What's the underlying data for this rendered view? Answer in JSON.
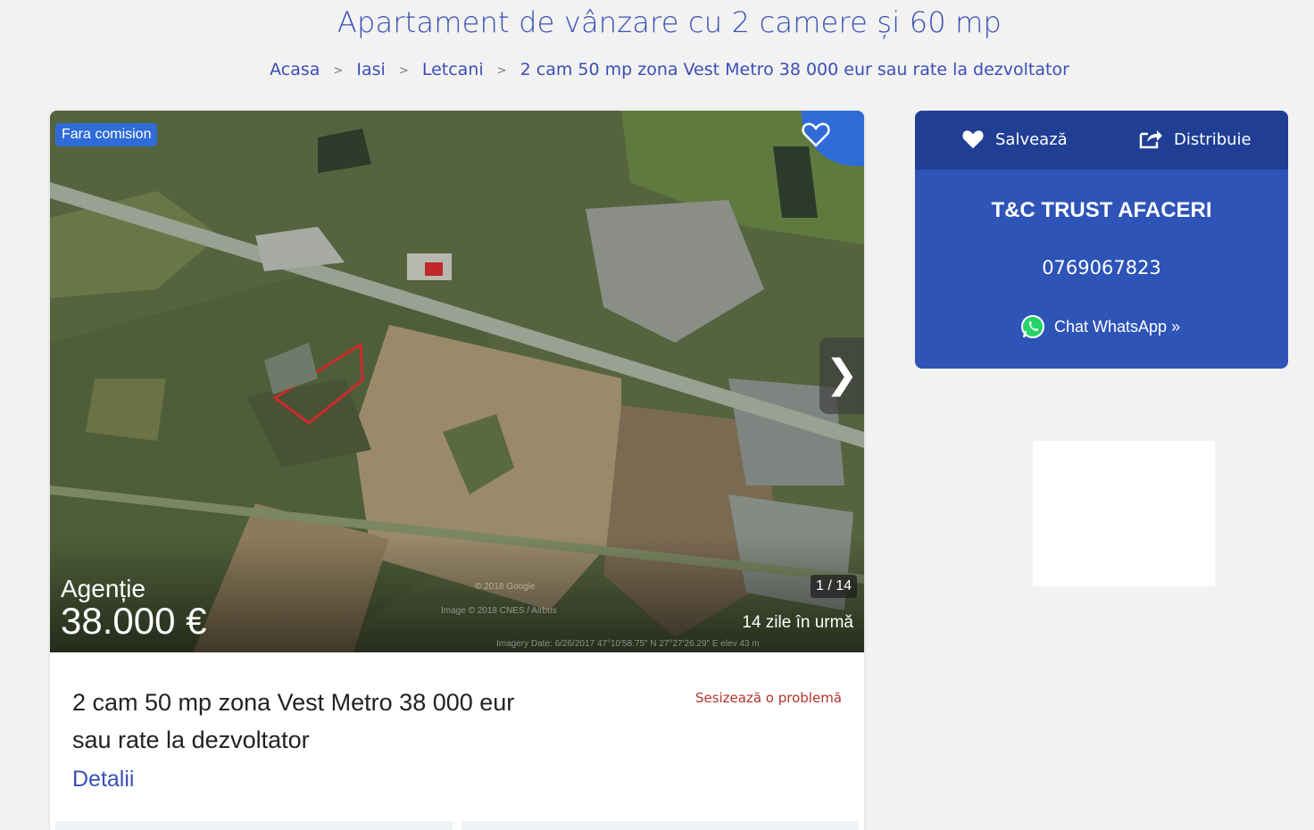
{
  "page": {
    "title": "Apartament de vânzare cu 2 camere și 60 mp"
  },
  "breadcrumb": {
    "items": [
      "Acasa",
      "Iasi",
      "Letcani",
      "2 cam 50 mp zona Vest Metro 38 000 eur sau rate la dezvoltator"
    ],
    "separator": ">"
  },
  "gallery": {
    "badge": "Fara comision",
    "seller_type": "Agenție",
    "price": "38.000 €",
    "counter": "1 / 14",
    "posted_ago": "14 zile în urmă",
    "next_icon": "chevron-right-icon",
    "favorite_icon": "heart-outline-icon",
    "watermarks": {
      "google": "© 2018 Google",
      "image": "Image © 2018 CNES / Airbus",
      "imagery": "Imagery Date: 6/26/2017     47°10'58.75\" N    27°27'26.29\" E   elev    43 m"
    }
  },
  "listing": {
    "title": "2 cam 50 mp zona Vest Metro 38 000 eur sau rate la dezvoltator",
    "report": "Sesizează o problemă",
    "details_link": "Detalii"
  },
  "agent": {
    "save_label": "Salvează",
    "share_label": "Distribuie",
    "name": "T&C TRUST AFACERI",
    "phone": "0769067823",
    "whatsapp_label": "Chat WhatsApp »"
  },
  "colors": {
    "accent": "#3a4fb5",
    "badge_blue": "#2f6cd8",
    "agent_box": "#2e54b8",
    "agent_header": "#1f3e94",
    "report_red": "#b3322b",
    "whatsapp_green": "#25d366"
  }
}
